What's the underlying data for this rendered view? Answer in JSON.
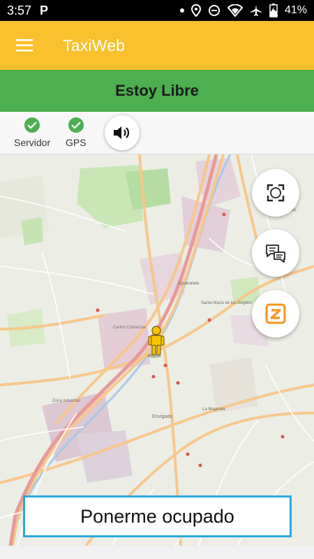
{
  "status_bar": {
    "time": "3:57",
    "notification_icon": "P",
    "battery_percent": "41%",
    "icons": [
      "dot-icon",
      "location-icon",
      "do-not-disturb-icon",
      "wifi-icon",
      "airplane-icon",
      "battery-charging-icon"
    ]
  },
  "app_bar": {
    "title": "TaxiWeb",
    "menu_icon": "hamburger-menu-icon",
    "background": "#FBC02D"
  },
  "banner": {
    "text": "Estoy Libre",
    "background": "#4CAF50"
  },
  "indicators": {
    "items": [
      {
        "label": "Servidor",
        "icon": "check-circle-icon",
        "status_color": "#4CAF50"
      },
      {
        "label": "GPS",
        "icon": "check-circle-icon",
        "status_color": "#4CAF50"
      }
    ],
    "sound_icon": "volume-icon"
  },
  "map": {
    "labels": [
      "Envigado",
      "Aguacatala",
      "El Poblado",
      "Santa María de los Ángeles",
      "La Magnolia",
      "Zona Industrial",
      "Centro Comercial"
    ],
    "marker_icon": "pegman-taxi-icon",
    "fab_icons": [
      "focus-frame-icon",
      "chat-bubbles-icon",
      "zello-icon"
    ]
  },
  "busy_button": {
    "label": "Ponerme ocupado",
    "border_color": "#29A9E1"
  }
}
